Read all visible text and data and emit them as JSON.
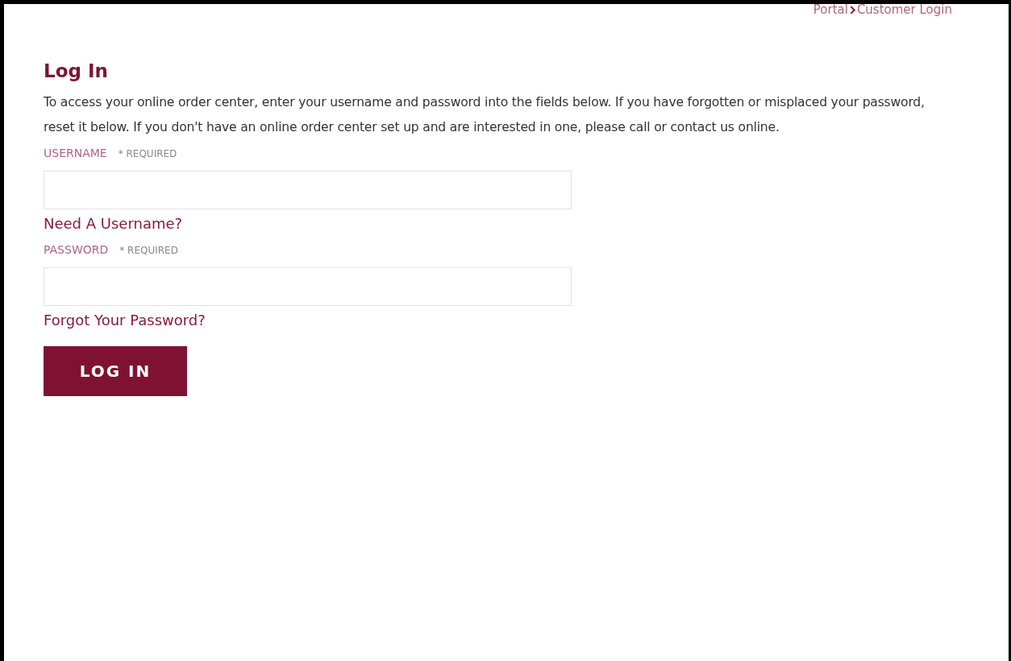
{
  "breadcrumb": [
    "Portal",
    "Customer Login"
  ],
  "heading": "Log In",
  "intro": "To access your online order center, enter your username and password into the fields below. If you have forgotten or misplaced your password, reset it below. If you don't have an online order center set up and are interested in one, please call or contact us online.",
  "fields": [
    {
      "label": "USERNAME",
      "required": "* REQUIRED",
      "link": "Need A Username?"
    },
    {
      "label": "PASSWORD",
      "required": "* REQUIRED",
      "link": "Forgot Your Password?"
    }
  ],
  "button": "LOG IN"
}
